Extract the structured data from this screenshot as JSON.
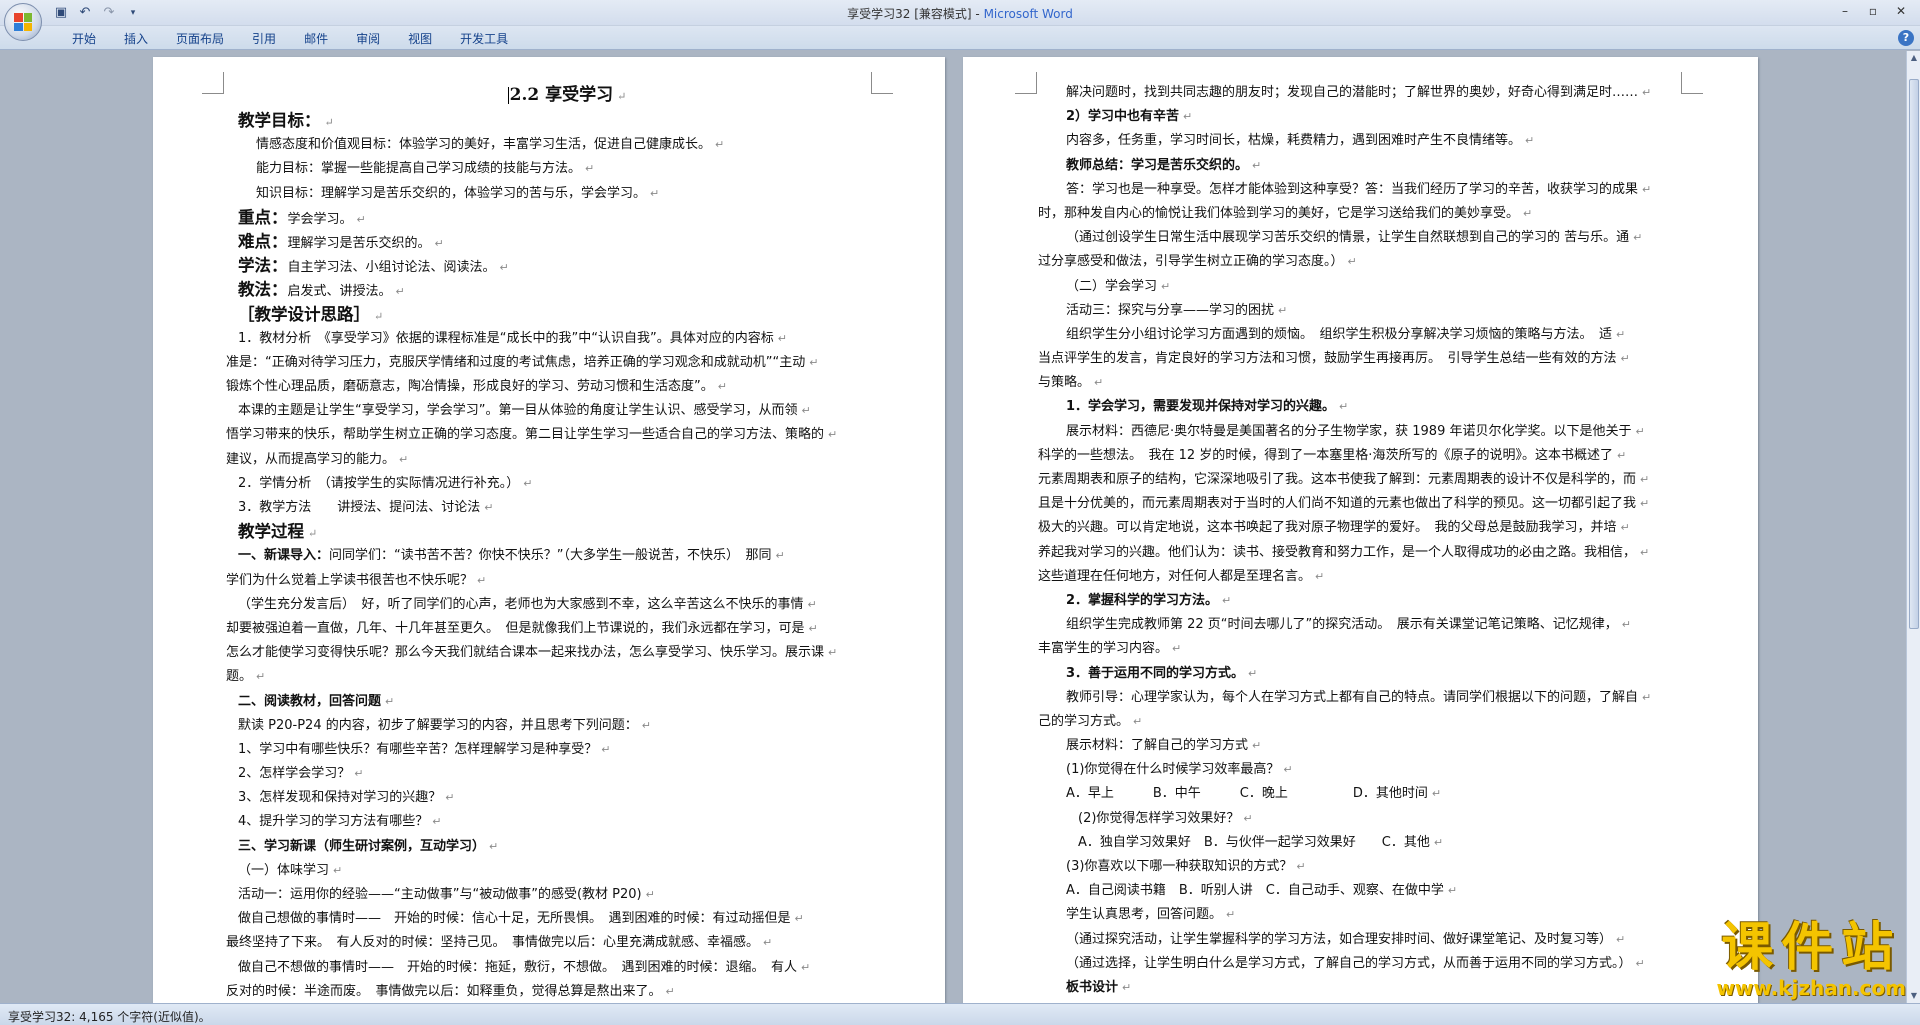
{
  "window": {
    "title_doc": "享受学习32 [兼容模式] - ",
    "title_app": "Microsoft Word"
  },
  "ribbon": {
    "tabs": [
      "开始",
      "插入",
      "页面布局",
      "引用",
      "邮件",
      "审阅",
      "视图",
      "开发工具"
    ]
  },
  "status": {
    "text": "享受学习32: 4,165 个字符(近似值)。"
  },
  "watermark": {
    "brand": "课件站",
    "url": "www.kjzhan.com"
  },
  "left_page": {
    "title": "2.2  享受学习",
    "lines": [
      {
        "t": "教学目标：",
        "s": "hd"
      },
      {
        "t": "情感态度和价值观目标：体验学习的美好，丰富学习生活，促进自己健康成长。",
        "s": "ind1"
      },
      {
        "t": "能力目标：掌握一些能提高自己学习成绩的技能与方法。",
        "s": "ind1"
      },
      {
        "t": "知识目标：理解学习是苦乐交织的，体验学习的苦与乐，学会学习。",
        "s": "ind1"
      },
      {
        "t": "重点：学会学习。",
        "s": "kv",
        "k": "重点：",
        "v": "学会学习。"
      },
      {
        "t": "难点：理解学习是苦乐交织的。",
        "s": "kv",
        "k": "难点：",
        "v": "理解学习是苦乐交织的。"
      },
      {
        "t": "学法：自主学习法、小组讨论法、阅读法。",
        "s": "kv",
        "k": "学法：",
        "v": "自主学习法、小组讨论法、阅读法。"
      },
      {
        "t": "教法：启发式、讲授法。",
        "s": "kv",
        "k": "教法：",
        "v": "启发式、讲授法。"
      },
      {
        "t": "［教学设计思路］",
        "s": "hd"
      },
      {
        "t": "1．教材分析　《享受学习》依据的课程标准是“成长中的我”中“认识自我”。具体对应的内容标",
        "s": "ind2"
      },
      {
        "t": "准是：“正确对待学习压力，克服厌学情绪和过度的考试焦虑，培养正确的学习观念和成就动机”“主动",
        "s": ""
      },
      {
        "t": "锻炼个性心理品质，磨砺意志，陶冶情操，形成良好的学习、劳动习惯和生活态度”。",
        "s": ""
      },
      {
        "t": "本课的主题是让学生“享受学习，学会学习”。第一目从体验的角度让学生认识、感受学习，从而领",
        "s": "ind2"
      },
      {
        "t": "悟学习带来的快乐，帮助学生树立正确的学习态度。第二目让学生学习一些适合自己的学习方法、策略的",
        "s": ""
      },
      {
        "t": "建议，从而提高学习的能力。",
        "s": ""
      },
      {
        "t": "2．学情分析　（请按学生的实际情况进行补充。）",
        "s": "ind2"
      },
      {
        "t": "3．教学方法　　讲授法、提问法、讨论法",
        "s": "ind2"
      },
      {
        "t": "教学过程",
        "s": "hd"
      },
      {
        "t": "一、新课导入：问同学们：“读书苦不苦？你快不快乐？”（大多学生一般说苦，不快乐）　那同",
        "s": "ind2 lead",
        "k": "一、新课导入：",
        "v": "问同学们：“读书苦不苦？你快不快乐？”（大多学生一般说苦，不快乐）　那同"
      },
      {
        "t": "学们为什么觉着上学读书很苦也不快乐呢？",
        "s": ""
      },
      {
        "t": "（学生充分发言后）　好，听了同学们的心声，老师也为大家感到不幸，这么辛苦这么不快乐的事情",
        "s": "ind2"
      },
      {
        "t": "却要被强迫着一直做，几年、十几年甚至更久。　但是就像我们上节课说的，我们永远都在学习，可是",
        "s": ""
      },
      {
        "t": "怎么才能使学习变得快乐呢？那么今天我们就结合课本一起来找办法，怎么享受学习、快乐学习。展示课",
        "s": ""
      },
      {
        "t": "题。",
        "s": ""
      },
      {
        "t": "二、阅读教材，回答问题",
        "s": "ind2 b"
      },
      {
        "t": "默读 P20-P24 的内容，初步了解要学习的内容，并且思考下列问题：",
        "s": "ind2"
      },
      {
        "t": "1、学习中有哪些快乐？有哪些辛苦？怎样理解学习是种享受？",
        "s": "ind2"
      },
      {
        "t": "2、怎样学会学习？",
        "s": "ind2"
      },
      {
        "t": "3、怎样发现和保持对学习的兴趣？",
        "s": "ind2"
      },
      {
        "t": "4、提升学习的学习方法有哪些？",
        "s": "ind2"
      },
      {
        "t": "三、学习新课（师生研讨案例，互动学习）",
        "s": "ind2 b"
      },
      {
        "t": "（一）体味学习",
        "s": "ind2"
      },
      {
        "t": "活动一：运用你的经验——“主动做事”与“被动做事”的感受(教材 P20)",
        "s": "ind2"
      },
      {
        "t": "做自己想做的事情时——　开始的时候：信心十足，无所畏惧。　遇到困难的时候：有过动摇但是",
        "s": "ind2"
      },
      {
        "t": "最终坚持了下来。　有人反对的时候：坚持己见。　事情做完以后：心里充满成就感、幸福感。",
        "s": ""
      },
      {
        "t": "做自己不想做的事情时——　开始的时候：拖延，敷衍，不想做。　遇到困难的时候：退缩。　有人",
        "s": "ind2"
      },
      {
        "t": "反对的时候：半途而废。　事情做完以后：如释重负，觉得总算是熬出来了。",
        "s": ""
      }
    ]
  },
  "right_page": {
    "lines": [
      {
        "t": "解决问题时，找到共同志趣的朋友时；发现自己的潜能时；了解世界的奥妙，好奇心得到满足时……",
        "s": "ind3"
      },
      {
        "t": "2）学习中也有辛苦",
        "s": "ind3 b"
      },
      {
        "t": "内容多，任务重，学习时间长，枯燥，耗费精力，遇到困难时产生不良情绪等。",
        "s": "ind3"
      },
      {
        "t": "教师总结：学习是苦乐交织的。",
        "s": "ind3 lead2",
        "k": "教师总结：",
        "v": "学习是苦乐交织的。"
      },
      {
        "t": "答：学习也是一种享受。怎样才能体验到这种享受？答：当我们经历了学习的辛苦，收获学习的成果",
        "s": "ind3"
      },
      {
        "t": "时，那种发自内心的愉悦让我们体验到学习的美好，它是学习送给我们的美妙享受。",
        "s": ""
      },
      {
        "t": "（通过创设学生日常生活中展现学习苦乐交织的情景，让学生自然联想到自己的学习的 苦与乐。通",
        "s": "ind3"
      },
      {
        "t": "过分享感受和做法，引导学生树立正确的学习态度。）",
        "s": ""
      },
      {
        "t": "（二）学会学习",
        "s": "ind3"
      },
      {
        "t": "活动三：探究与分享——学习的困扰",
        "s": "ind3"
      },
      {
        "t": "组织学生分小组讨论学习方面遇到的烦恼。　组织学生积极分享解决学习烦恼的策略与方法。　适",
        "s": "ind3"
      },
      {
        "t": "当点评学生的发言，肯定良好的学习方法和习惯，鼓励学生再接再厉。　引导学生总结一些有效的方法",
        "s": ""
      },
      {
        "t": "与策略。",
        "s": ""
      },
      {
        "t": "1．学会学习，需要发现并保持对学习的兴趣。",
        "s": "ind3 b"
      },
      {
        "t": "展示材料：西德尼·奥尔特曼是美国著名的分子生物学家，获 1989 年诺贝尔化学奖。以下是他关于",
        "s": "ind3"
      },
      {
        "t": "科学的一些想法。　我在 12 岁的时候，得到了一本塞里格·海茨所写的《原子的说明》。这本书概述了",
        "s": ""
      },
      {
        "t": "元素周期表和原子的结构，它深深地吸引了我。这本书使我了解到：元素周期表的设计不仅是科学的，而",
        "s": ""
      },
      {
        "t": "且是十分优美的，而元素周期表对于当时的人们尚不知道的元素也做出了科学的预见。这一切都引起了我",
        "s": ""
      },
      {
        "t": "极大的兴趣。可以肯定地说，这本书唤起了我对原子物理学的爱好。　我的父母总是鼓励我学习，并培",
        "s": ""
      },
      {
        "t": "养起我对学习的兴趣。他们认为：读书、接受教育和努力工作，是一个人取得成功的必由之路。我相信，",
        "s": ""
      },
      {
        "t": "这些道理在任何地方，对任何人都是至理名言。",
        "s": ""
      },
      {
        "t": "2．掌握科学的学习方法。",
        "s": "ind3 b"
      },
      {
        "t": "组织学生完成教师第 22 页“时间去哪儿了”的探究活动。　展示有关课堂记笔记策略、记忆规律，",
        "s": "ind3"
      },
      {
        "t": "丰富学生的学习内容。",
        "s": ""
      },
      {
        "t": "3．善于运用不同的学习方式。",
        "s": "ind3 b"
      },
      {
        "t": "教师引导：心理学家认为，每个人在学习方式上都有自己的特点。请同学们根据以下的问题，了解自",
        "s": "ind3"
      },
      {
        "t": "己的学习方式。",
        "s": ""
      },
      {
        "t": "展示材料：了解自己的学习方式",
        "s": "ind3"
      },
      {
        "t": "(1)你觉得在什么时候学习效率最高？",
        "s": "ind3"
      },
      {
        "t": "A．早上　　　B．中午　　　C．晚上　　　　　D．其他时间",
        "s": "ind3"
      },
      {
        "t": "(2)你觉得怎样学习效果好？",
        "s": "ind3 x"
      },
      {
        "t": "A．独自学习效果好　B．与伙伴一起学习效果好　　C．其他",
        "s": "ind3 x"
      },
      {
        "t": "(3)你喜欢以下哪一种获取知识的方式？",
        "s": "ind3"
      },
      {
        "t": "A．自己阅读书籍　B．听别人讲　C．自己动手、观察、在做中学",
        "s": "ind3"
      },
      {
        "t": "学生认真思考，回答问题。",
        "s": "ind3"
      },
      {
        "t": "（通过探究活动，让学生掌握科学的学习方法，如合理安排时间、做好课堂笔记、及时复习等）",
        "s": "ind3"
      },
      {
        "t": "（通过选择，让学生明白什么是学习方式，了解自己的学习方式，从而善于运用不同的学习方式。）",
        "s": "ind3"
      },
      {
        "t": "板书设计",
        "s": "ind3 b"
      }
    ]
  },
  "colors": {
    "accent": "#15428b",
    "app_title": "#3366cc",
    "workspace": "#abb5c3",
    "watermark": "#f4c400"
  },
  "icons": [
    "office-button-icon",
    "save-icon",
    "undo-icon",
    "redo-icon",
    "customize-qat-icon",
    "minimize-icon",
    "maximize-icon",
    "close-icon",
    "help-icon",
    "scroll-up-icon",
    "scroll-down-icon"
  ]
}
